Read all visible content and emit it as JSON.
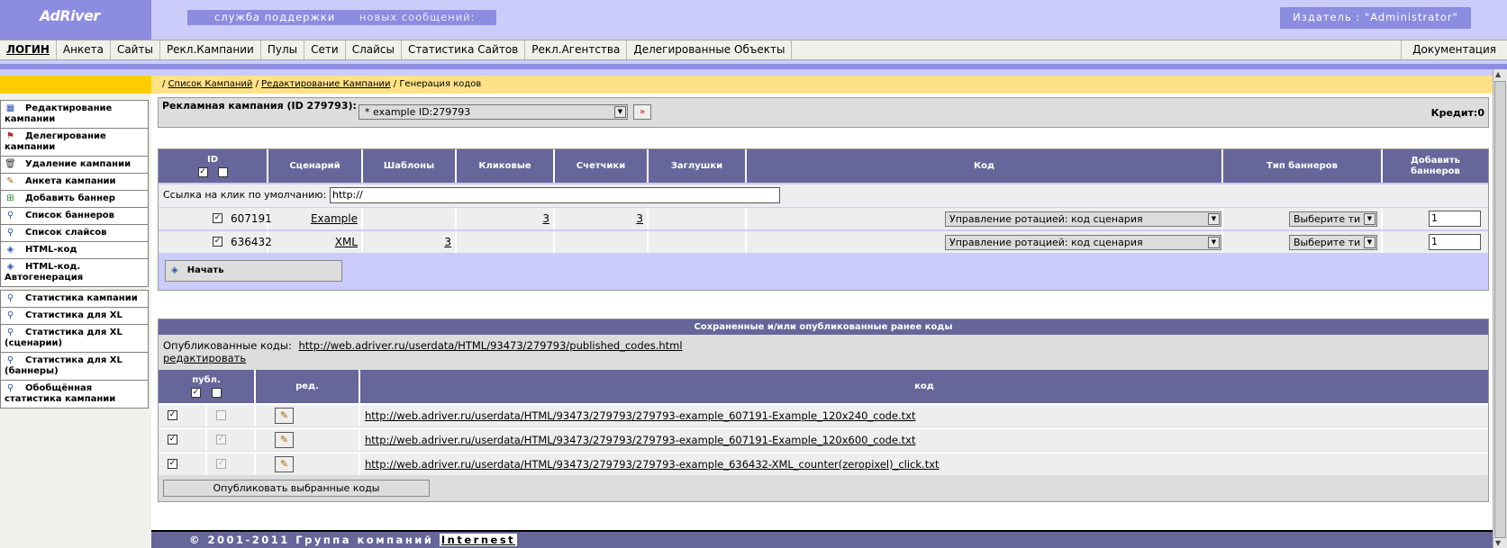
{
  "header": {
    "logo": "AdRiver",
    "support": "служба поддержки",
    "new_messages": "новых сообщений:",
    "publisher": "Издатель : \"Administrator\""
  },
  "nav": {
    "items": [
      "ЛОГИН",
      "Анкета",
      "Сайты",
      "Рекл.Кампании",
      "Пулы",
      "Сети",
      "Слайсы",
      "Статистика Сайтов",
      "Рекл.Агентства",
      "Делегированные Объекты"
    ],
    "right": "Документация"
  },
  "sidebar": {
    "items": [
      {
        "label": "Редактирование кампании",
        "icon": "grid-icon"
      },
      {
        "label": "Делегирование кампании",
        "icon": "flag-icon"
      },
      {
        "label": "Удаление кампании",
        "icon": "trash-icon"
      },
      {
        "label": "Анкета кампании",
        "icon": "pencil-icon"
      },
      {
        "label": "Добавить баннер",
        "icon": "add-icon"
      },
      {
        "label": "Список баннеров",
        "icon": "magnifier-icon"
      },
      {
        "label": "Список слайсов",
        "icon": "magnifier-icon"
      },
      {
        "label": "HTML-код",
        "icon": "code-icon"
      },
      {
        "label": "HTML-код. Автогенерация",
        "icon": "code-icon"
      },
      {
        "label": "Статистика кампании",
        "icon": "magnifier-icon"
      },
      {
        "label": "Статистика для XL",
        "icon": "magnifier-icon"
      },
      {
        "label": "Статистика для XL (сценарии)",
        "icon": "magnifier-icon"
      },
      {
        "label": "Статистика для XL (баннеры)",
        "icon": "magnifier-icon"
      },
      {
        "label": "Обобщённая статистика кампании",
        "icon": "magnifier-icon"
      }
    ]
  },
  "breadcrumb": {
    "sep": "/",
    "campaign_list": "Список Кампаний",
    "campaign_edit": "Редактирование Кампании",
    "current": "Генерация кодов"
  },
  "campaign": {
    "label": "Рекламная кампания (ID 279793):",
    "selected": "* example ID:279793",
    "credit": "Кредит:0"
  },
  "generator": {
    "headers": {
      "id": "ID",
      "scenario": "Сценарий",
      "templates": "Шаблоны",
      "clicks": "Кликовые",
      "counters": "Счетчики",
      "stubs": "Заглушки",
      "code": "Код",
      "banner_type": "Тип баннеров",
      "add_banners": "Добавить баннеров"
    },
    "default_link_label": "Ссылка на клик по умолчанию:",
    "default_link_value": "http://",
    "rows": [
      {
        "id": "607191",
        "scenario": "Example",
        "templates": "",
        "clicks": "3",
        "counters": "3",
        "stubs": "",
        "code": "Управление ротацией: код сценария",
        "type": "Выберите ти",
        "add": "1"
      },
      {
        "id": "636432",
        "scenario": "XML",
        "templates": "3",
        "clicks": "",
        "counters": "",
        "stubs": "",
        "code": "Управление ротацией: код сценария",
        "type": "Выберите ти",
        "add": "1"
      }
    ],
    "start_label": "Начать"
  },
  "saved": {
    "title": "Сохраненные и/или опубликованные ранее коды",
    "published_label": "Опубликованные коды:",
    "published_url": "http://web.adriver.ru/userdata/HTML/93473/279793/published_codes.html",
    "edit_label": "редактировать",
    "headers": {
      "publ": "публ.",
      "edit": "ред.",
      "code": "код"
    },
    "rows": [
      {
        "url": "http://web.adriver.ru/userdata/HTML/93473/279793/279793-example_607191-Example_120x240_code.txt"
      },
      {
        "url": "http://web.adriver.ru/userdata/HTML/93473/279793/279793-example_607191-Example_120x600_code.txt"
      },
      {
        "url": "http://web.adriver.ru/userdata/HTML/93473/279793/279793-example_636432-XML_counter(zeropixel)_click.txt"
      }
    ],
    "publish_label": "Опубликовать выбранные коды"
  },
  "footer": {
    "text": "© 2001-2011 Группа компаний",
    "brand": "Internest"
  },
  "colors": {
    "accent": "#8c8ce0",
    "light": "#ccccfa",
    "table_header": "#66669a",
    "breadcrumb_bg": "#ffe287",
    "yellow": "#ffcc00"
  }
}
